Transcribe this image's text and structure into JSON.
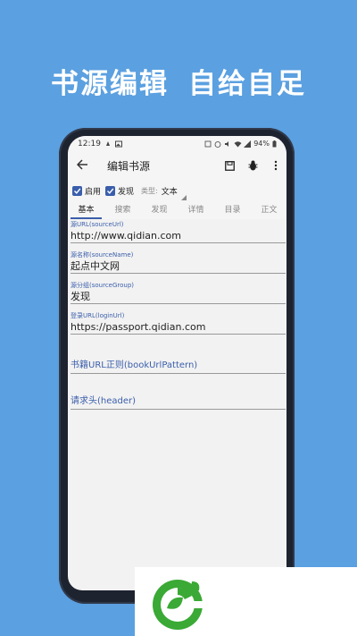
{
  "headline": {
    "part1": "书源编辑",
    "part2": "自给自足"
  },
  "status": {
    "time": "12:19",
    "battery": "94%"
  },
  "appbar": {
    "title": "编辑书源",
    "icons": [
      "back-arrow-icon",
      "save-icon",
      "bug-icon",
      "more-vert-icon"
    ]
  },
  "options": {
    "enable_label": "启用",
    "enable_checked": true,
    "discover_label": "发现",
    "discover_checked": true,
    "type_label": "类型:",
    "type_value": "文本"
  },
  "tabs": [
    {
      "label": "基本",
      "active": true
    },
    {
      "label": "搜索",
      "active": false
    },
    {
      "label": "发现",
      "active": false
    },
    {
      "label": "详情",
      "active": false
    },
    {
      "label": "目录",
      "active": false
    },
    {
      "label": "正文",
      "active": false
    }
  ],
  "fields": [
    {
      "label": "源URL(sourceUrl)",
      "value": "http://www.qidian.com"
    },
    {
      "label": "源名称(sourceName)",
      "value": "起点中文网"
    },
    {
      "label": "源分组(sourceGroup)",
      "value": "发现"
    },
    {
      "label": "登录URL(loginUrl)",
      "value": "https://passport.qidian.com"
    },
    {
      "label": "",
      "value": "书籍URL正则(bookUrlPattern)"
    },
    {
      "label": "",
      "value": "请求头(header)"
    }
  ],
  "colors": {
    "background": "#5ba0e0",
    "accent": "#3a5eab",
    "logo_green": "#3aa935"
  }
}
